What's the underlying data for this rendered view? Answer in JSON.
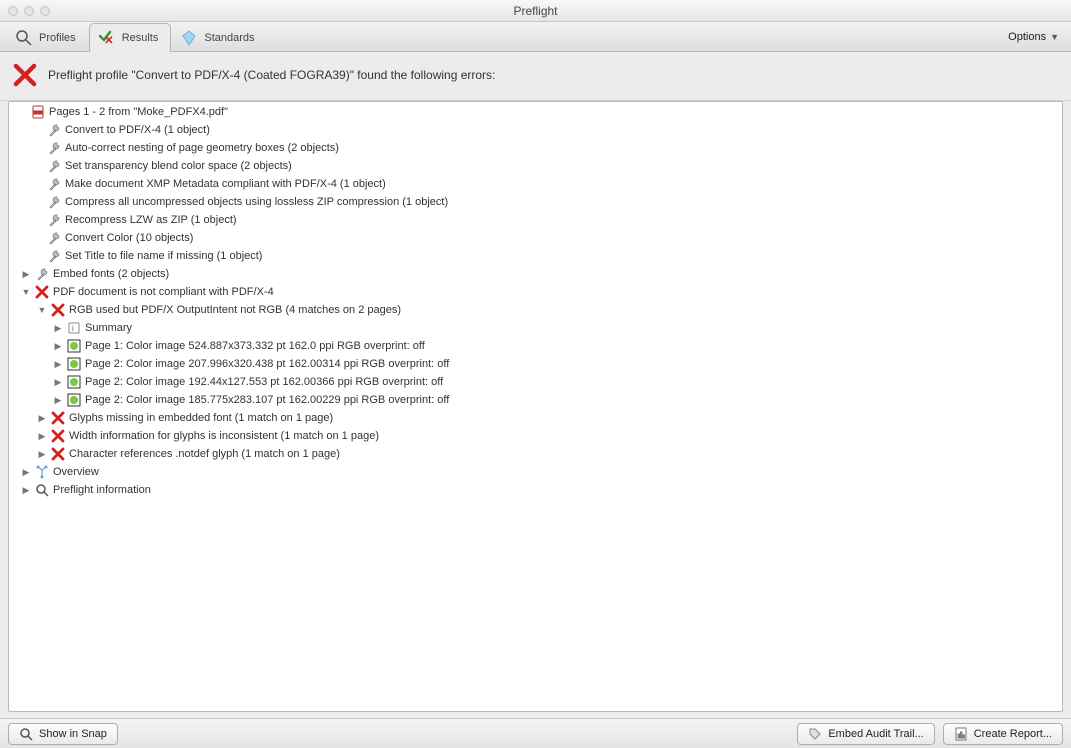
{
  "window": {
    "title": "Preflight"
  },
  "tabs": {
    "profiles": "Profiles",
    "results": "Results",
    "standards": "Standards"
  },
  "options_label": "Options",
  "summary": "Preflight profile \"Convert to PDF/X-4 (Coated FOGRA39)\" found the following errors:",
  "tree": {
    "root": "Pages 1 - 2 from \"Moke_PDFX4.pdf\"",
    "fixups": [
      "Convert to PDF/X-4 (1 object)",
      "Auto-correct nesting of page geometry boxes (2 objects)",
      "Set transparency blend color space (2 objects)",
      "Make document XMP Metadata compliant with PDF/X-4 (1 object)",
      "Compress all uncompressed objects using lossless ZIP compression (1 object)",
      "Recompress LZW as ZIP (1 object)",
      "Convert Color (10 objects)",
      "Set Title to file name if missing (1 object)"
    ],
    "embed_fonts": "Embed fonts (2 objects)",
    "noncompliant": "PDF document is not compliant with PDF/X-4",
    "rgb_header": "RGB used but PDF/X OutputIntent not RGB (4 matches on 2 pages)",
    "rgb_summary": "Summary",
    "rgb_matches": [
      "Page 1: Color image 524.887x373.332 pt 162.0 ppi RGB  overprint: off",
      "Page 2: Color image 207.996x320.438 pt 162.00314 ppi RGB  overprint: off",
      "Page 2: Color image 192.44x127.553 pt 162.00366 ppi RGB  overprint: off",
      "Page 2: Color image 185.775x283.107 pt 162.00229 ppi RGB  overprint: off"
    ],
    "glyphs_missing": "Glyphs missing in embedded font (1 match on 1 page)",
    "width_inconsistent": "Width information for glyphs is inconsistent (1 match on 1 page)",
    "notdef": "Character references .notdef glyph (1 match on 1 page)",
    "overview": "Overview",
    "preflight_info": "Preflight information"
  },
  "footer": {
    "show_in_snap": "Show in Snap",
    "embed_audit": "Embed Audit Trail...",
    "create_report": "Create Report..."
  }
}
